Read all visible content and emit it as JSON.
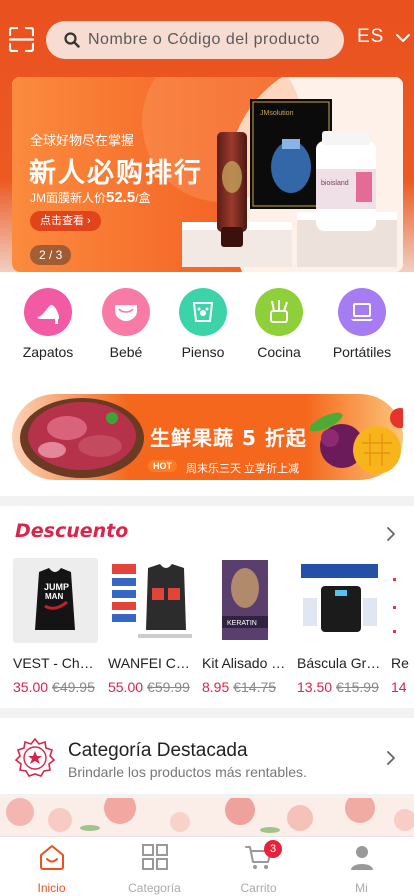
{
  "header": {
    "search_placeholder": "Nombre o Código del producto",
    "language": "ES",
    "accent_color": "#e9511f"
  },
  "banner": {
    "subtitle": "全球好物尽在掌握",
    "title": "新人必购排行",
    "price_prefix": "JM面膜新人价",
    "price_value": "52.5",
    "price_suffix": "/盒",
    "button_label": "点击查看 ›",
    "pager": "2 / 3"
  },
  "categories": [
    {
      "label": "Zapatos",
      "icon": "high-heel-icon",
      "color": "#f25ba3"
    },
    {
      "label": "Bebé",
      "icon": "diaper-icon",
      "color": "#f87aa6"
    },
    {
      "label": "Pienso",
      "icon": "pet-food-icon",
      "color": "#3dd3a8"
    },
    {
      "label": "Cocina",
      "icon": "kitchen-utensils-icon",
      "color": "#8fcf3a"
    },
    {
      "label": "Portátiles",
      "icon": "laptop-icon",
      "color": "#a57cf2"
    }
  ],
  "promo": {
    "title": "生鲜果蔬 5 折起",
    "hot_tag": "HOT",
    "subtitle": "周末乐三天 立享折上减"
  },
  "discount": {
    "title": "Descuento",
    "products": [
      {
        "name": "VEST - Champion",
        "price": "35.00",
        "old_price": "€49.95"
      },
      {
        "name": "WANFEI Chaleco",
        "price": "55.00",
        "old_price": "€59.99"
      },
      {
        "name": "Kit Alisado Keratin",
        "price": "8.95",
        "old_price": "€14.75"
      },
      {
        "name": "Báscula Grasa",
        "price": "13.50",
        "old_price": "€15.99"
      },
      {
        "name": "Re",
        "price": "14",
        "old_price": ""
      }
    ]
  },
  "featured": {
    "title": "Categoría Destacada",
    "subtitle": "Brindarle los productos más rentables."
  },
  "tabbar": {
    "tabs": [
      {
        "label": "Inicio"
      },
      {
        "label": "Categoría"
      },
      {
        "label": "Carrito"
      },
      {
        "label": "Mi"
      }
    ],
    "cart_badge": "3"
  }
}
